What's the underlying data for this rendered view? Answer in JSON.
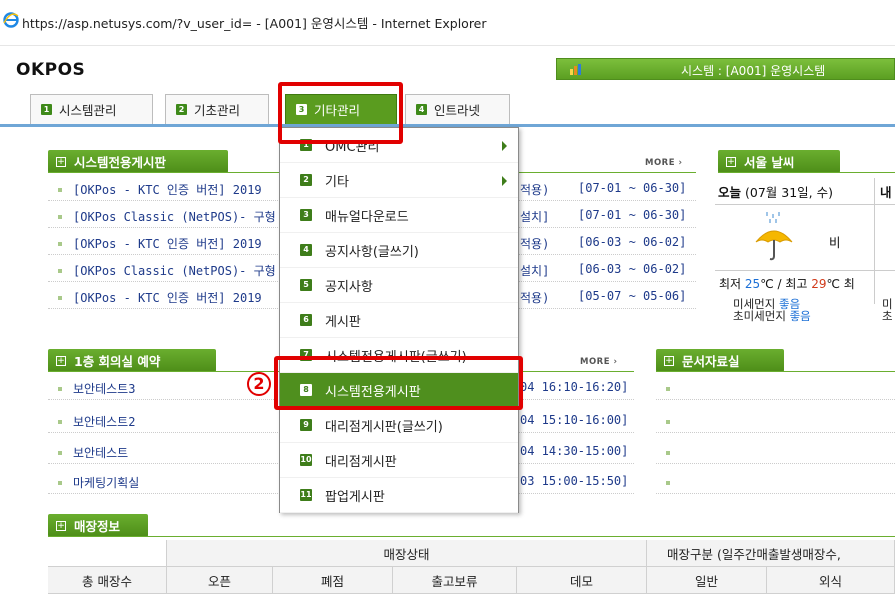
{
  "window": {
    "title": "https://asp.netusys.com/?v_user_id= - [A001] 운영시스템 - Internet Explorer"
  },
  "header": {
    "logo": "OKPOS",
    "system_label": "시스템 : [A001] 운영시스템"
  },
  "tabs": [
    {
      "num": "1",
      "label": "시스템관리"
    },
    {
      "num": "2",
      "label": "기초관리"
    },
    {
      "num": "3",
      "label": "기타관리"
    },
    {
      "num": "4",
      "label": "인트라넷"
    }
  ],
  "board": {
    "title": "시스템전용게시판",
    "more": "MORE",
    "rows": [
      {
        "text": "[OKPos - KTC 인증 버전] 2019",
        "tail": "적용)",
        "date": "[07-01 ~ 06-30]"
      },
      {
        "text": "[OKPos Classic (NetPOS)- 구형",
        "tail": "설치]",
        "date": "[07-01 ~ 06-30]"
      },
      {
        "text": "[OKPos - KTC 인증 버전] 2019",
        "tail": "적용)",
        "date": "[06-03 ~ 06-02]"
      },
      {
        "text": "[OKPos Classic (NetPOS)- 구형",
        "tail": "설치]",
        "date": "[06-03 ~ 06-02]"
      },
      {
        "text": "[OKPos - KTC 인증 버전] 2019",
        "tail": "적용)",
        "date": "[05-07 ~ 05-06]"
      }
    ]
  },
  "meeting": {
    "title": "1층 회의실 예약",
    "more": "MORE",
    "rows": [
      {
        "text": "보안테스트3",
        "date": "04 16:10-16:20]"
      },
      {
        "text": "보안테스트2",
        "date": "04 15:10-16:00]"
      },
      {
        "text": "보안테스트",
        "date": "04 14:30-15:00]"
      },
      {
        "text": "마케팅기획실",
        "date": "03 15:00-15:50]"
      }
    ]
  },
  "docs": {
    "title": "문서자료실"
  },
  "weather": {
    "title": "서울 날씨",
    "today_bold": "오늘",
    "today_date": " (07월 31일, 수)",
    "next_label": "내",
    "condition": "비",
    "temp_prefix": "최저 ",
    "temp_low": "25",
    "temp_mid": "℃ / 최고 ",
    "temp_high": "29",
    "temp_suffix": "℃ 최",
    "dust1_label": "미세먼지 ",
    "dust1_value": "좋음",
    "dust2_label": "초미세먼지 ",
    "dust2_value": "좋음",
    "dust_next1": "미",
    "dust_next2": "초"
  },
  "store": {
    "title": "매장정보",
    "group1": "매장상태",
    "group2": "매장구분 (일주간매출발생매장수,",
    "columns": [
      "총 매장수",
      "오픈",
      "폐점",
      "출고보류",
      "데모",
      "일반",
      "외식"
    ]
  },
  "menu": {
    "items": [
      {
        "num": "1",
        "label": "OMC관리",
        "submenu": true
      },
      {
        "num": "2",
        "label": "기타",
        "submenu": true
      },
      {
        "num": "3",
        "label": "매뉴얼다운로드"
      },
      {
        "num": "4",
        "label": "공지사항(글쓰기)"
      },
      {
        "num": "5",
        "label": "공지사항"
      },
      {
        "num": "6",
        "label": "게시판"
      },
      {
        "num": "7",
        "label": "시스템전용게시판(글쓰기)"
      },
      {
        "num": "8",
        "label": "시스템전용게시판"
      },
      {
        "num": "9",
        "label": "대리점게시판(글쓰기)"
      },
      {
        "num": "10",
        "label": "대리점게시판"
      },
      {
        "num": "11",
        "label": "팝업게시판"
      }
    ],
    "active_index": 7
  },
  "annotation": {
    "step": "2"
  },
  "colors": {
    "accent_green": "#5a9c1f",
    "highlight_red": "#e10000",
    "nav_blue": "#6fa6d6"
  }
}
